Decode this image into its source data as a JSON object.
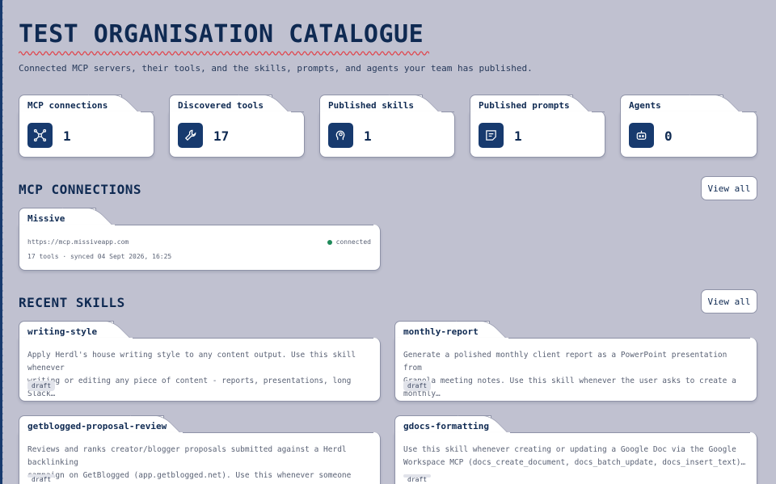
{
  "header": {
    "title": "TEST ORGANISATION CATALOGUE",
    "subtitle": "Connected MCP servers, their tools, and the skills, prompts, and agents your team has published.",
    "accent_color": "#e0484f"
  },
  "stats": [
    {
      "label": "MCP connections",
      "value": "1",
      "icon": "network-icon"
    },
    {
      "label": "Discovered tools",
      "value": "17",
      "icon": "wrench-icon"
    },
    {
      "label": "Published skills",
      "value": "1",
      "icon": "skill-head-icon"
    },
    {
      "label": "Published prompts",
      "value": "1",
      "icon": "note-icon"
    },
    {
      "label": "Agents",
      "value": "0",
      "icon": "robot-icon"
    }
  ],
  "mcp_section": {
    "title": "MCP CONNECTIONS",
    "view_all": "View all",
    "connections": [
      {
        "name": "Missive",
        "url": "https://mcp.missiveapp.com",
        "status": "connected",
        "status_color": "#1f8a5a",
        "meta": "17 tools · synced 04 Sept 2026, 16:25"
      }
    ]
  },
  "skills_section": {
    "title": "RECENT SKILLS",
    "view_all": "View all",
    "skills": [
      {
        "name": "writing-style",
        "line1": "Apply Herdl's house writing style to any content output. Use this skill whenever",
        "line2": "writing or editing any piece of content - reports, presentations, long Slack…",
        "status": "draft"
      },
      {
        "name": "monthly-report",
        "line1": "Generate a polished monthly client report as a PowerPoint presentation from",
        "line2": "Granola meeting notes. Use this skill whenever the user asks to create a monthly…",
        "status": "draft"
      },
      {
        "name": "getblogged-proposal-review",
        "line1": "Reviews and ranks creator/blogger proposals submitted against a Herdl backlinking",
        "line2": "campaign on GetBlogged (app.getblogged.net). Use this whenever someone asks to…",
        "status": "draft"
      },
      {
        "name": "gdocs-formatting",
        "line1": "Use this skill whenever creating or updating a Google Doc via the Google",
        "line2": "Workspace MCP (docs_create_document, docs_batch_update, docs_insert_text)…",
        "status": "draft"
      }
    ]
  }
}
